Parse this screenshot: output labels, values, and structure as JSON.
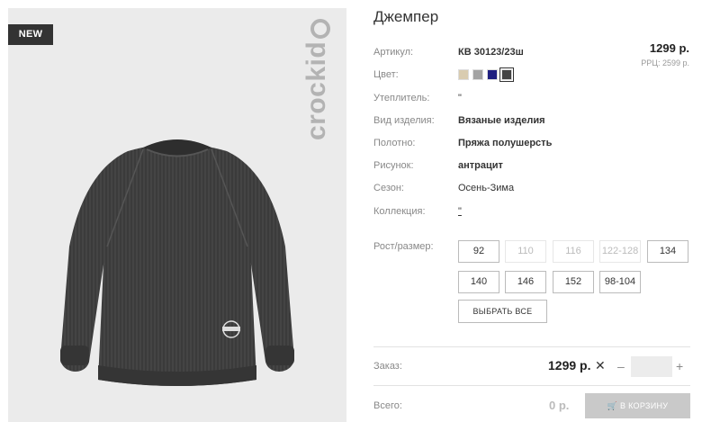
{
  "product": {
    "badge": "NEW",
    "brand": "crockid",
    "title": "Джемпер",
    "price": "1299 р.",
    "rrp": "РРЦ: 2599 р."
  },
  "attributes": [
    {
      "label": "Артикул:",
      "value": "КВ 30123/23ш"
    },
    {
      "label": "Цвет:",
      "value": ""
    },
    {
      "label": "Утеплитель:",
      "value": "\""
    },
    {
      "label": "Вид изделия:",
      "value": "Вязаные изделия"
    },
    {
      "label": "Полотно:",
      "value": "Пряжа полушерсть"
    },
    {
      "label": "Рисунок:",
      "value": "антрацит"
    },
    {
      "label": "Сезон:",
      "value": "Осень-Зима"
    },
    {
      "label": "Коллекция:",
      "value": "\""
    }
  ],
  "colors": [
    {
      "name": "beige",
      "hex": "#d9ccb0",
      "selected": false
    },
    {
      "name": "grey",
      "hex": "#a3a3a3",
      "selected": false
    },
    {
      "name": "navy",
      "hex": "#1f1f80",
      "selected": false
    },
    {
      "name": "anthracite",
      "hex": "#444444",
      "selected": true
    }
  ],
  "sizes": {
    "label": "Рост/размер:",
    "options": [
      {
        "value": "92",
        "available": true
      },
      {
        "value": "110",
        "available": false
      },
      {
        "value": "116",
        "available": false
      },
      {
        "value": "122-128",
        "available": false
      },
      {
        "value": "134",
        "available": true
      },
      {
        "value": "140",
        "available": true
      },
      {
        "value": "146",
        "available": true
      },
      {
        "value": "152",
        "available": true
      },
      {
        "value": "98-104",
        "available": true
      }
    ],
    "select_all": "ВЫБРАТЬ ВСЕ"
  },
  "order": {
    "label": "Заказ:",
    "price": "1299 р.",
    "times": "✕",
    "minus": "–",
    "plus": "+",
    "quantity": ""
  },
  "total": {
    "label": "Всего:",
    "value": "0 р.",
    "cart_button": "В КОРЗИНУ"
  }
}
